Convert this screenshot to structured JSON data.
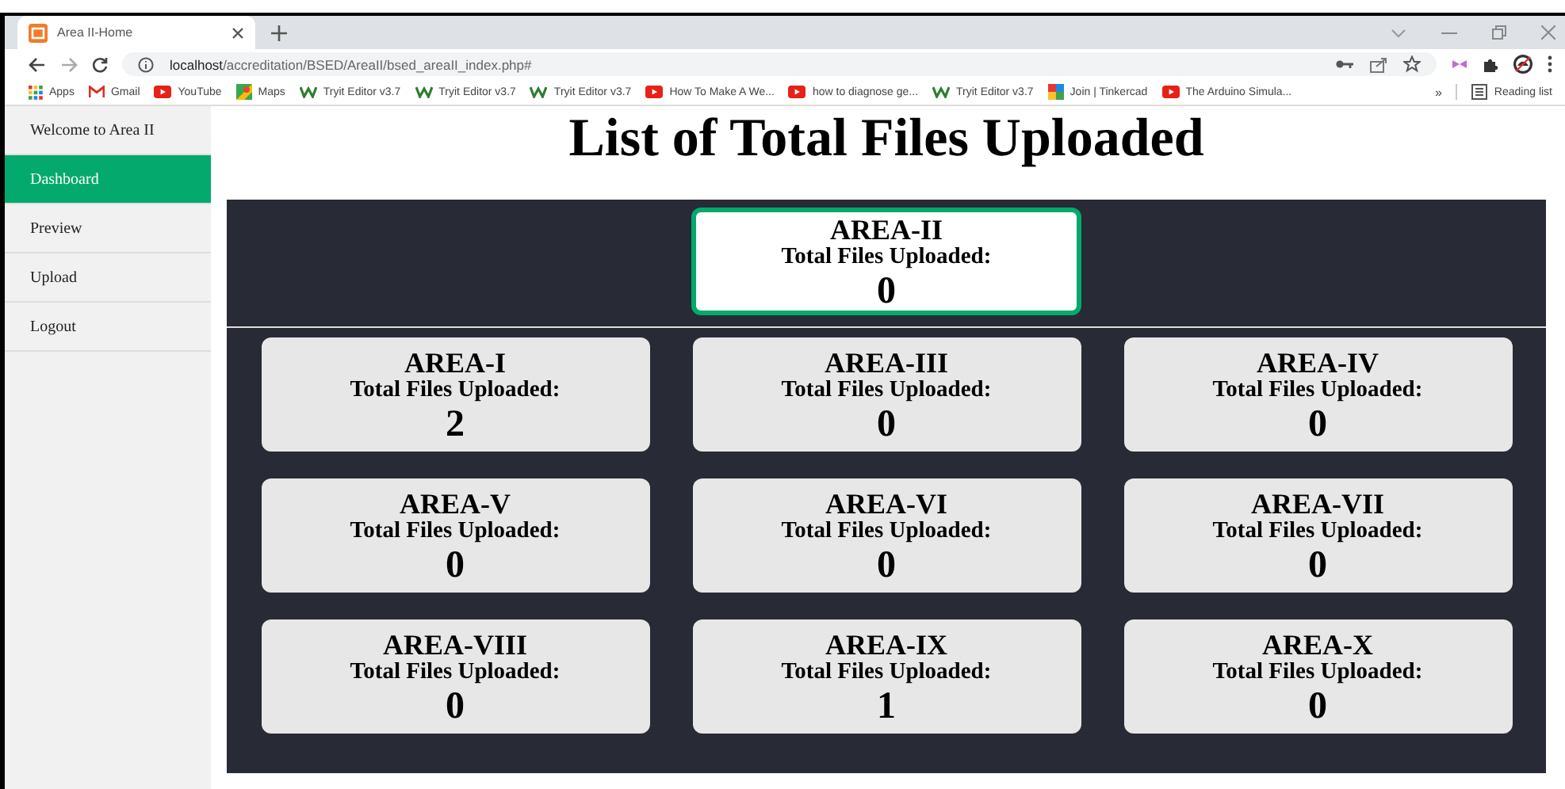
{
  "browser": {
    "tab_title": "Area II-Home",
    "url_host": "localhost",
    "url_path": "/accreditation/BSED/AreaII/bsed_areaII_index.php#",
    "bookmarks": [
      {
        "kind": "apps",
        "label": "Apps"
      },
      {
        "kind": "gmail",
        "label": "Gmail"
      },
      {
        "kind": "youtube",
        "label": "YouTube"
      },
      {
        "kind": "maps",
        "label": "Maps"
      },
      {
        "kind": "w3",
        "label": "Tryit Editor v3.7"
      },
      {
        "kind": "w3",
        "label": "Tryit Editor v3.7"
      },
      {
        "kind": "w3",
        "label": "Tryit Editor v3.7"
      },
      {
        "kind": "youtube",
        "label": "How To Make A We..."
      },
      {
        "kind": "youtube",
        "label": "how to diagnose ge..."
      },
      {
        "kind": "w3",
        "label": "Tryit Editor v3.7"
      },
      {
        "kind": "tinkercad",
        "label": "Join | Tinkercad"
      },
      {
        "kind": "youtube",
        "label": "The Arduino Simula..."
      }
    ],
    "more": "»",
    "reading_list": "Reading list"
  },
  "sidebar": {
    "items": [
      {
        "label": "Welcome to Area II",
        "selected": false
      },
      {
        "label": "Dashboard",
        "selected": true
      },
      {
        "label": "Preview",
        "selected": false
      },
      {
        "label": "Upload",
        "selected": false
      },
      {
        "label": "Logout",
        "selected": false
      }
    ]
  },
  "page_title": "List of Total Files Uploaded",
  "featured": {
    "area": "AREA-II",
    "label": "Total Files Uploaded:",
    "count": "0"
  },
  "areas": [
    {
      "area": "AREA-I",
      "label": "Total Files Uploaded:",
      "count": "2"
    },
    {
      "area": "AREA-III",
      "label": "Total Files Uploaded:",
      "count": "0"
    },
    {
      "area": "AREA-IV",
      "label": "Total Files Uploaded:",
      "count": "0"
    },
    {
      "area": "AREA-V",
      "label": "Total Files Uploaded:",
      "count": "0"
    },
    {
      "area": "AREA-VI",
      "label": "Total Files Uploaded:",
      "count": "0"
    },
    {
      "area": "AREA-VII",
      "label": "Total Files Uploaded:",
      "count": "0"
    },
    {
      "area": "AREA-VIII",
      "label": "Total Files Uploaded:",
      "count": "0"
    },
    {
      "area": "AREA-IX",
      "label": "Total Files Uploaded:",
      "count": "1"
    },
    {
      "area": "AREA-X",
      "label": "Total Files Uploaded:",
      "count": "0"
    }
  ]
}
